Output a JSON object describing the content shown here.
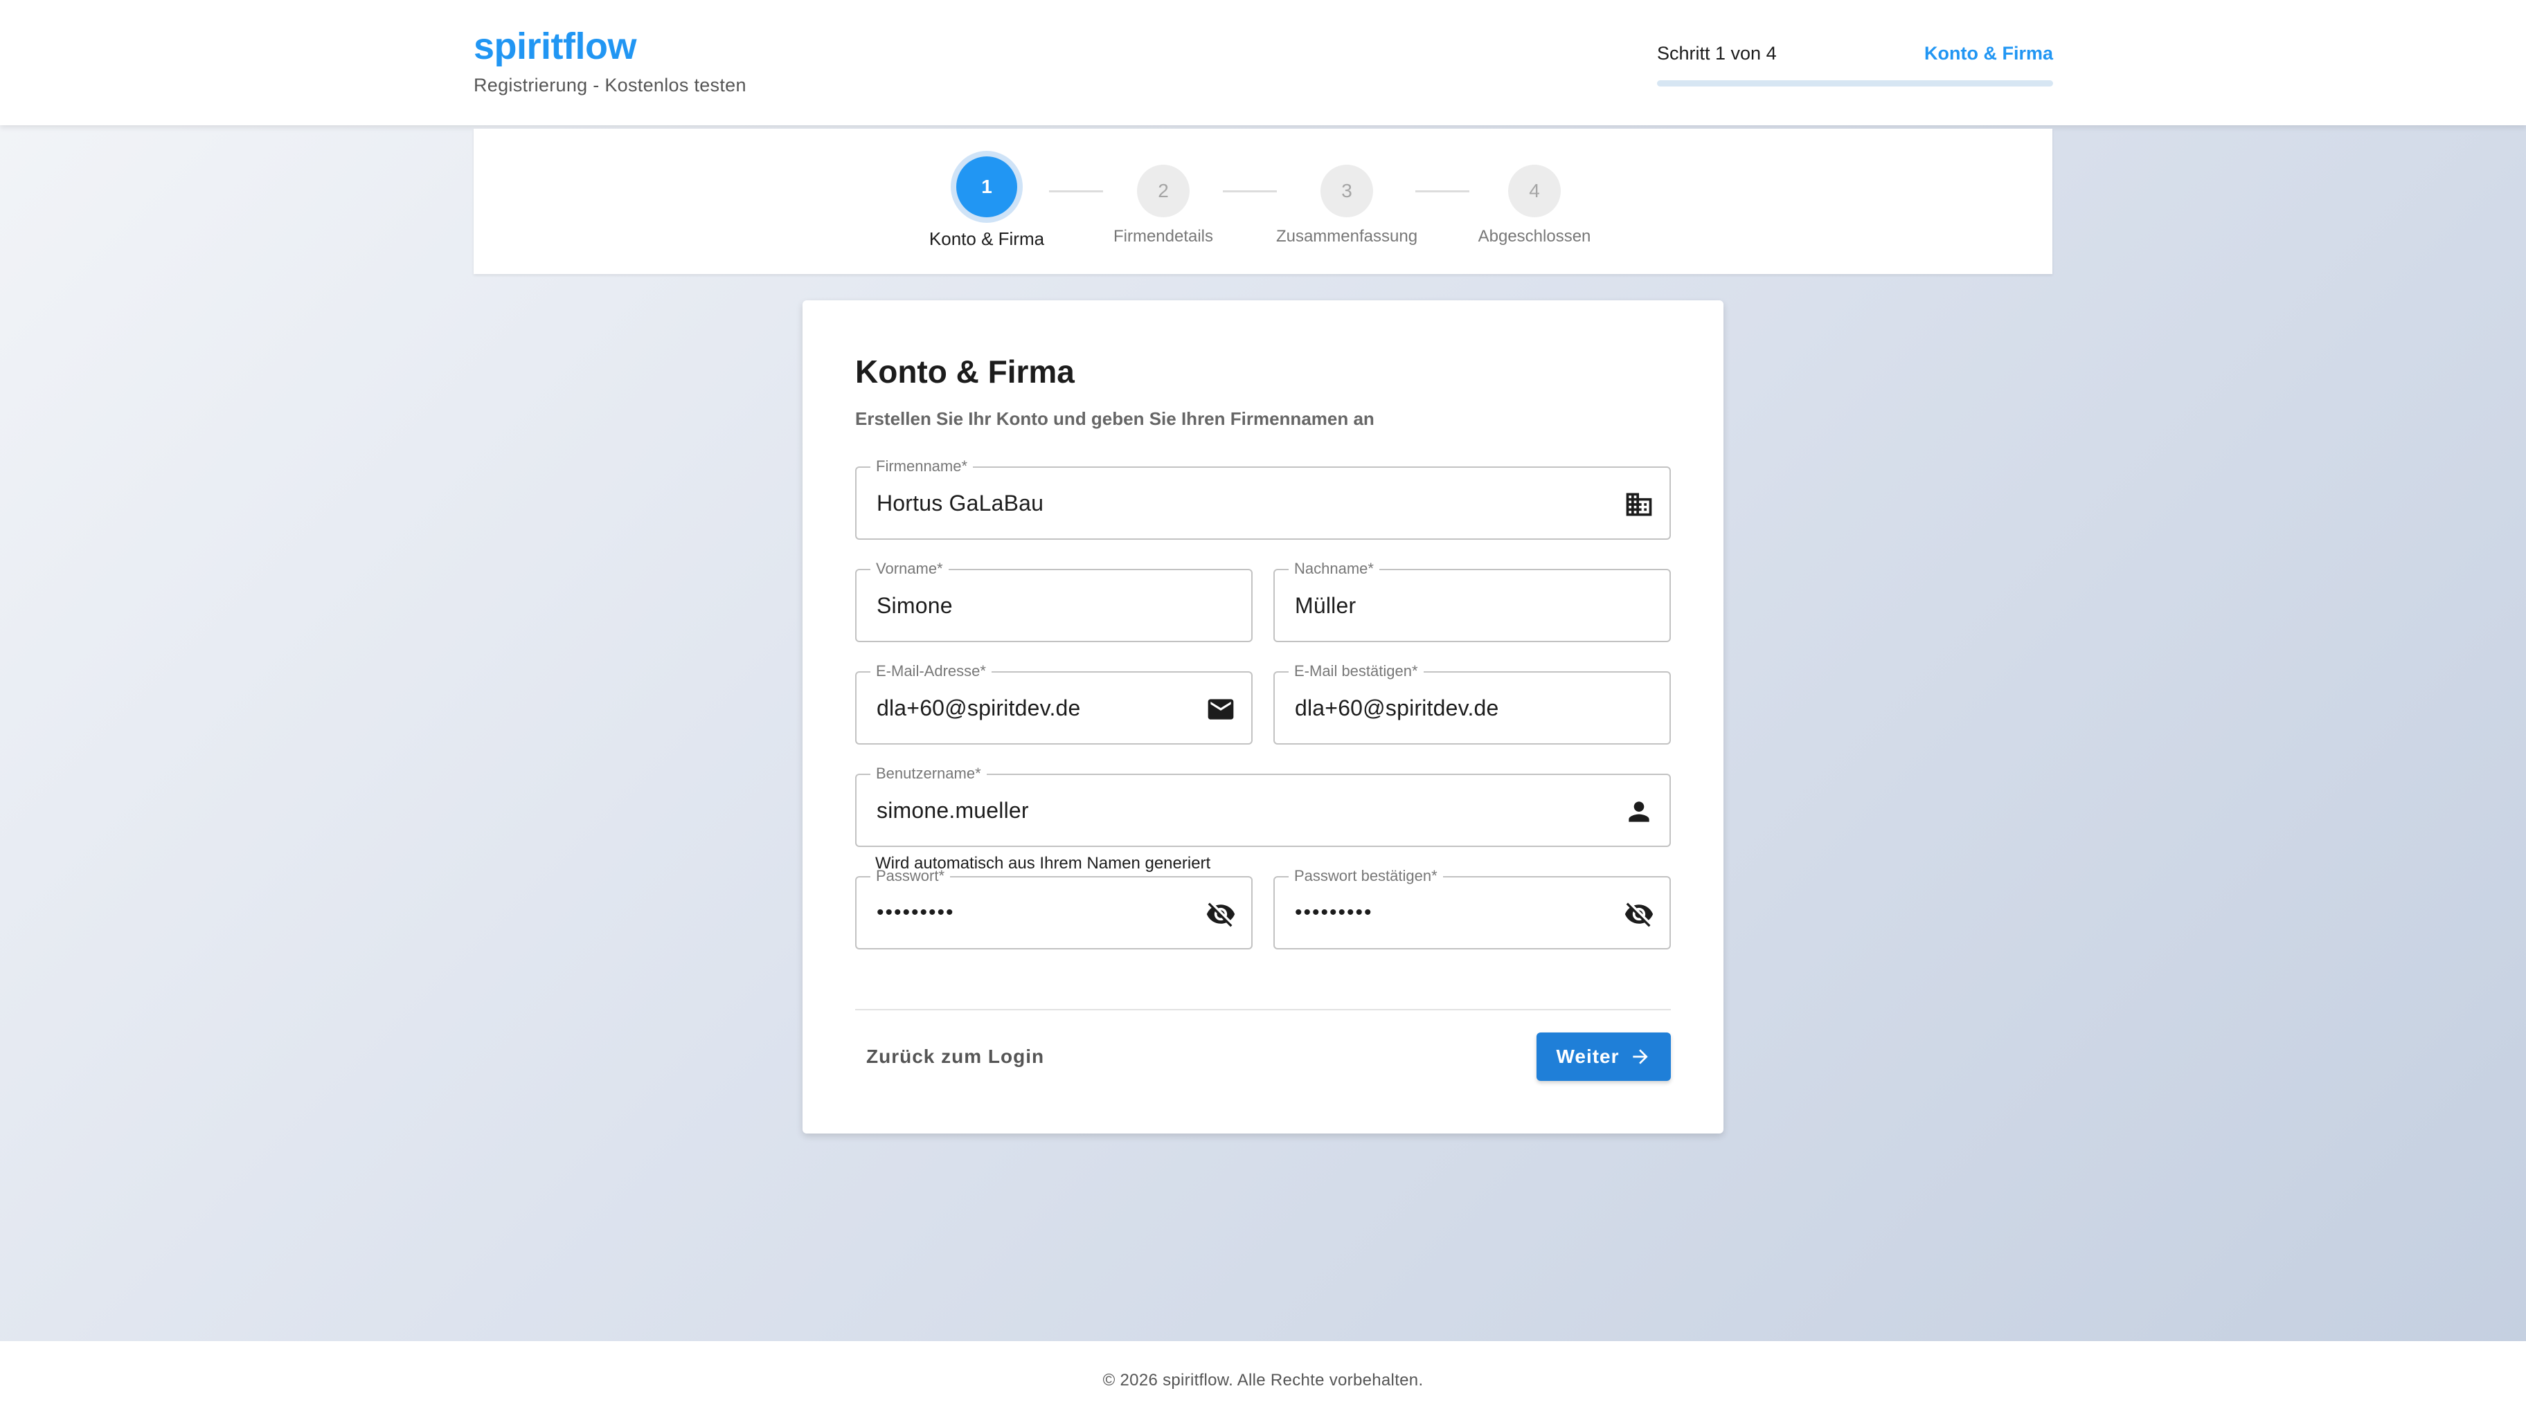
{
  "header": {
    "brand": "spiritflow",
    "subtitle": "Registrierung - Kostenlos testen",
    "step_count": "Schritt 1 von 4",
    "step_name": "Konto & Firma"
  },
  "stepper": {
    "steps": [
      {
        "number": "1",
        "label": "Konto & Firma"
      },
      {
        "number": "2",
        "label": "Firmendetails"
      },
      {
        "number": "3",
        "label": "Zusammenfassung"
      },
      {
        "number": "4",
        "label": "Abgeschlossen"
      }
    ]
  },
  "form": {
    "title": "Konto & Firma",
    "subtitle": "Erstellen Sie Ihr Konto und geben Sie Ihren Firmennamen an",
    "company": {
      "label": "Firmenname*",
      "value": "Hortus GaLaBau",
      "icon": "business-icon"
    },
    "first_name": {
      "label": "Vorname*",
      "value": "Simone"
    },
    "last_name": {
      "label": "Nachname*",
      "value": "Müller"
    },
    "email": {
      "label": "E-Mail-Adresse*",
      "value": "dla+60@spiritdev.de",
      "icon": "mail-icon"
    },
    "email_confirm": {
      "label": "E-Mail bestätigen*",
      "value": "dla+60@spiritdev.de"
    },
    "username": {
      "label": "Benutzername*",
      "value": "simone.mueller",
      "hint": "Wird automatisch aus Ihrem Namen generiert",
      "icon": "person-icon"
    },
    "password": {
      "label": "Passwort*",
      "value": "•••••••••",
      "icon": "visibility-off-icon"
    },
    "password_confirm": {
      "label": "Passwort bestätigen*",
      "value": "•••••••••",
      "icon": "visibility-off-icon"
    },
    "back_label": "Zurück zum Login",
    "next_label": "Weiter"
  },
  "footer": {
    "text": "© 2026 spiritflow. Alle Rechte vorbehalten."
  },
  "colors": {
    "accent": "#2196f3",
    "button": "#1f7fd8"
  }
}
